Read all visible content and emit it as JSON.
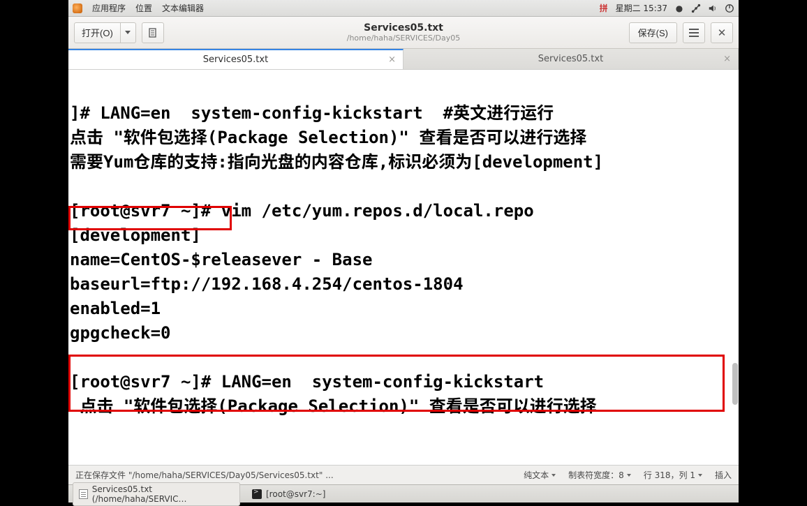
{
  "menubar": {
    "apps": "应用程序",
    "places": "位置",
    "editor": "文本编辑器",
    "datetime": "星期二 15:37"
  },
  "window": {
    "open_label": "打开(O)",
    "title": "Services05.txt",
    "subtitle": "/home/haha/SERVICES/Day05",
    "save_label": "保存(S)"
  },
  "tabs": [
    {
      "label": "Services05.txt"
    },
    {
      "label": "Services05.txt"
    }
  ],
  "content": {
    "l1": "]# LANG=en  system-config-kickstart  #英文进行运行",
    "l2": "点击 \"软件包选择(Package Selection)\" 查看是否可以进行选择",
    "l3": "需要Yum仓库的支持:指向光盘的内容仓库,标识必须为[development]",
    "l4": "",
    "l5": "[root@svr7 ~]# vim /etc/yum.repos.d/local.repo",
    "l6": "[development]",
    "l7": "name=CentOS-$releasever - Base",
    "l8": "baseurl=ftp://192.168.4.254/centos-1804",
    "l9": "enabled=1",
    "l10": "gpgcheck=0",
    "l11": "",
    "l12": "[root@svr7 ~]# LANG=en  system-config-kickstart",
    "l13": " 点击 \"软件包选择(Package Selection)\" 查看是否可以进行选择"
  },
  "status": {
    "saving": "正在保存文件 \"/home/haha/SERVICES/Day05/Services05.txt\" ...",
    "lang": "纯文本",
    "tabwidth": "制表符宽度：8",
    "pos": "行 318，列 1",
    "mode": "插入"
  },
  "taskbar": {
    "item1": "Services05.txt (/home/haha/SERVIC…",
    "item2": "[root@svr7:~]"
  },
  "colors": {
    "accent": "#3584e4",
    "highlight_border": "#e00000"
  }
}
